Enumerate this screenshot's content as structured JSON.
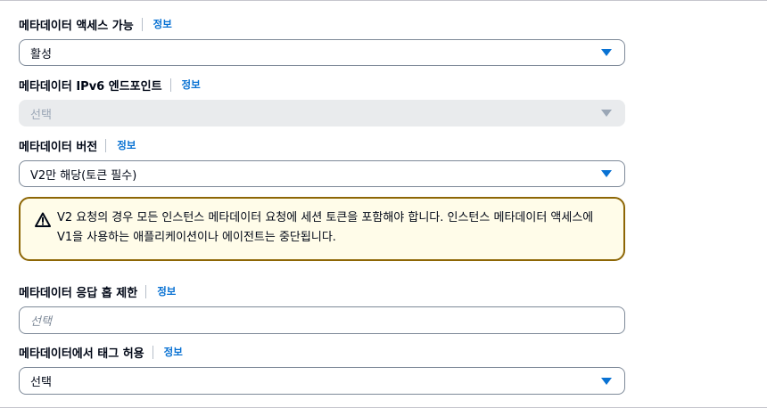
{
  "info_link": "정보",
  "fields": {
    "metadata_access": {
      "label": "메타데이터 액세스 가능",
      "value": "활성"
    },
    "ipv6_endpoint": {
      "label": "메타데이터 IPv6 엔드포인트",
      "value": "선택"
    },
    "metadata_version": {
      "label": "메타데이터 버전",
      "value": "V2만 해당(토큰 필수)"
    },
    "hop_limit": {
      "label": "메타데이터 응답 홉 제한",
      "placeholder": "선택"
    },
    "tags": {
      "label": "메타데이터에서 태그 허용",
      "value": "선택"
    }
  },
  "warning": {
    "icon": "warning-icon",
    "text": "V2 요청의 경우 모든 인스턴스 메타데이터 요청에 세션 토큰을 포함해야 합니다. 인스턴스 메타데이터 액세스에 V1을 사용하는 애플리케이션이나 에이전트는 중단됩니다."
  },
  "colors": {
    "link": "#0972d3",
    "warning_border": "#8d6605",
    "warning_bg": "#fffce9"
  }
}
